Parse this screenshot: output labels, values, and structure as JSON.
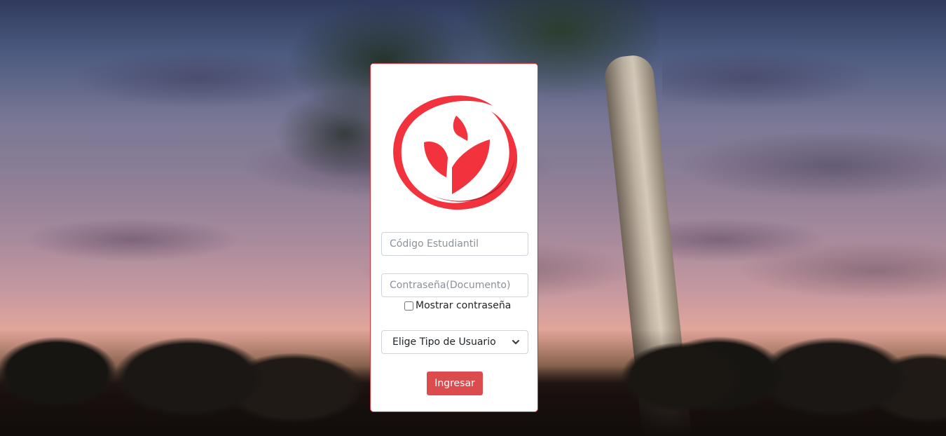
{
  "login": {
    "code_placeholder": "Código Estudiantil",
    "password_placeholder": "Contraseña(Documento)",
    "show_password_label": "Mostrar contraseña",
    "show_password_checked": false,
    "user_type_selected": "Elige Tipo de Usuario",
    "submit_label": "Ingresar"
  },
  "icons": {
    "logo": "university-leaf-logo",
    "select_arrow": "chevron-down-icon"
  },
  "colors": {
    "brand_red": "#f2333d",
    "brand_dark_red": "#b3252d",
    "card_border": "#d9343d",
    "button_bg": "#dc4c4f"
  }
}
